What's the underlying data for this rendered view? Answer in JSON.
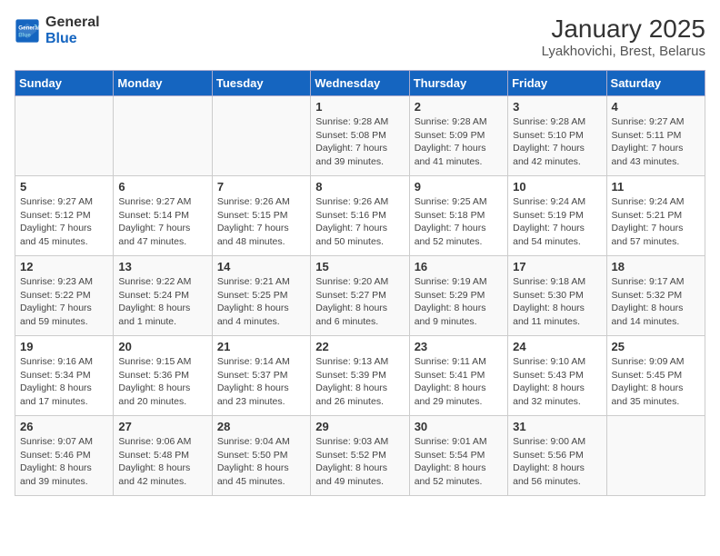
{
  "header": {
    "logo_line1": "General",
    "logo_line2": "Blue",
    "title": "January 2025",
    "subtitle": "Lyakhovichi, Brest, Belarus"
  },
  "calendar": {
    "weekdays": [
      "Sunday",
      "Monday",
      "Tuesday",
      "Wednesday",
      "Thursday",
      "Friday",
      "Saturday"
    ],
    "weeks": [
      [
        {
          "day": "",
          "info": ""
        },
        {
          "day": "",
          "info": ""
        },
        {
          "day": "",
          "info": ""
        },
        {
          "day": "1",
          "info": "Sunrise: 9:28 AM\nSunset: 5:08 PM\nDaylight: 7 hours\nand 39 minutes."
        },
        {
          "day": "2",
          "info": "Sunrise: 9:28 AM\nSunset: 5:09 PM\nDaylight: 7 hours\nand 41 minutes."
        },
        {
          "day": "3",
          "info": "Sunrise: 9:28 AM\nSunset: 5:10 PM\nDaylight: 7 hours\nand 42 minutes."
        },
        {
          "day": "4",
          "info": "Sunrise: 9:27 AM\nSunset: 5:11 PM\nDaylight: 7 hours\nand 43 minutes."
        }
      ],
      [
        {
          "day": "5",
          "info": "Sunrise: 9:27 AM\nSunset: 5:12 PM\nDaylight: 7 hours\nand 45 minutes."
        },
        {
          "day": "6",
          "info": "Sunrise: 9:27 AM\nSunset: 5:14 PM\nDaylight: 7 hours\nand 47 minutes."
        },
        {
          "day": "7",
          "info": "Sunrise: 9:26 AM\nSunset: 5:15 PM\nDaylight: 7 hours\nand 48 minutes."
        },
        {
          "day": "8",
          "info": "Sunrise: 9:26 AM\nSunset: 5:16 PM\nDaylight: 7 hours\nand 50 minutes."
        },
        {
          "day": "9",
          "info": "Sunrise: 9:25 AM\nSunset: 5:18 PM\nDaylight: 7 hours\nand 52 minutes."
        },
        {
          "day": "10",
          "info": "Sunrise: 9:24 AM\nSunset: 5:19 PM\nDaylight: 7 hours\nand 54 minutes."
        },
        {
          "day": "11",
          "info": "Sunrise: 9:24 AM\nSunset: 5:21 PM\nDaylight: 7 hours\nand 57 minutes."
        }
      ],
      [
        {
          "day": "12",
          "info": "Sunrise: 9:23 AM\nSunset: 5:22 PM\nDaylight: 7 hours\nand 59 minutes."
        },
        {
          "day": "13",
          "info": "Sunrise: 9:22 AM\nSunset: 5:24 PM\nDaylight: 8 hours\nand 1 minute."
        },
        {
          "day": "14",
          "info": "Sunrise: 9:21 AM\nSunset: 5:25 PM\nDaylight: 8 hours\nand 4 minutes."
        },
        {
          "day": "15",
          "info": "Sunrise: 9:20 AM\nSunset: 5:27 PM\nDaylight: 8 hours\nand 6 minutes."
        },
        {
          "day": "16",
          "info": "Sunrise: 9:19 AM\nSunset: 5:29 PM\nDaylight: 8 hours\nand 9 minutes."
        },
        {
          "day": "17",
          "info": "Sunrise: 9:18 AM\nSunset: 5:30 PM\nDaylight: 8 hours\nand 11 minutes."
        },
        {
          "day": "18",
          "info": "Sunrise: 9:17 AM\nSunset: 5:32 PM\nDaylight: 8 hours\nand 14 minutes."
        }
      ],
      [
        {
          "day": "19",
          "info": "Sunrise: 9:16 AM\nSunset: 5:34 PM\nDaylight: 8 hours\nand 17 minutes."
        },
        {
          "day": "20",
          "info": "Sunrise: 9:15 AM\nSunset: 5:36 PM\nDaylight: 8 hours\nand 20 minutes."
        },
        {
          "day": "21",
          "info": "Sunrise: 9:14 AM\nSunset: 5:37 PM\nDaylight: 8 hours\nand 23 minutes."
        },
        {
          "day": "22",
          "info": "Sunrise: 9:13 AM\nSunset: 5:39 PM\nDaylight: 8 hours\nand 26 minutes."
        },
        {
          "day": "23",
          "info": "Sunrise: 9:11 AM\nSunset: 5:41 PM\nDaylight: 8 hours\nand 29 minutes."
        },
        {
          "day": "24",
          "info": "Sunrise: 9:10 AM\nSunset: 5:43 PM\nDaylight: 8 hours\nand 32 minutes."
        },
        {
          "day": "25",
          "info": "Sunrise: 9:09 AM\nSunset: 5:45 PM\nDaylight: 8 hours\nand 35 minutes."
        }
      ],
      [
        {
          "day": "26",
          "info": "Sunrise: 9:07 AM\nSunset: 5:46 PM\nDaylight: 8 hours\nand 39 minutes."
        },
        {
          "day": "27",
          "info": "Sunrise: 9:06 AM\nSunset: 5:48 PM\nDaylight: 8 hours\nand 42 minutes."
        },
        {
          "day": "28",
          "info": "Sunrise: 9:04 AM\nSunset: 5:50 PM\nDaylight: 8 hours\nand 45 minutes."
        },
        {
          "day": "29",
          "info": "Sunrise: 9:03 AM\nSunset: 5:52 PM\nDaylight: 8 hours\nand 49 minutes."
        },
        {
          "day": "30",
          "info": "Sunrise: 9:01 AM\nSunset: 5:54 PM\nDaylight: 8 hours\nand 52 minutes."
        },
        {
          "day": "31",
          "info": "Sunrise: 9:00 AM\nSunset: 5:56 PM\nDaylight: 8 hours\nand 56 minutes."
        },
        {
          "day": "",
          "info": ""
        }
      ]
    ]
  }
}
